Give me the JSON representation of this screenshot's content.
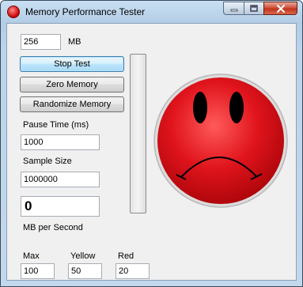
{
  "window": {
    "title": "Memory Performance Tester",
    "icon": "app-icon",
    "caption_buttons": [
      "minimize-icon",
      "maximize-icon",
      "close-icon"
    ]
  },
  "memory": {
    "value": "256",
    "unit_label": "MB"
  },
  "buttons": {
    "stop_test": "Stop Test",
    "zero_memory": "Zero Memory",
    "randomize_memory": "Randomize Memory"
  },
  "pause_time": {
    "label": "Pause Time (ms)",
    "value": "1000"
  },
  "sample_size": {
    "label": "Sample Size",
    "value": "1000000"
  },
  "rate": {
    "value": "0",
    "label": "MB per Second"
  },
  "progress": {
    "fraction": 0
  },
  "thresholds": {
    "max": {
      "label": "Max",
      "value": "100"
    },
    "yellow": {
      "label": "Yellow",
      "value": "50"
    },
    "red": {
      "label": "Red",
      "value": "20"
    }
  },
  "status_face": {
    "icon": "sad-face-icon",
    "color": "#e0141c",
    "mood": "sad"
  }
}
